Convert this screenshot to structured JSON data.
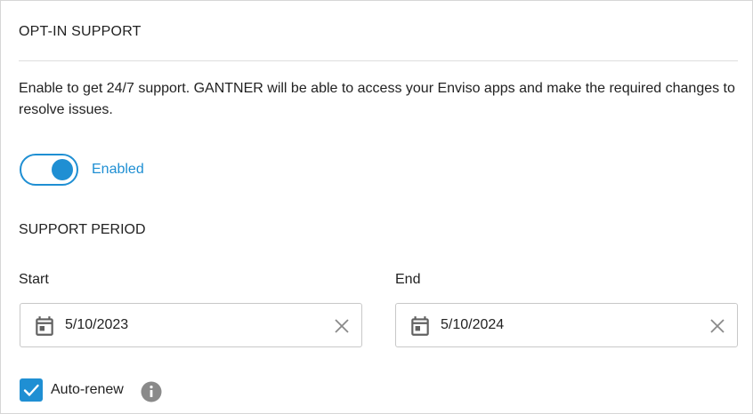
{
  "section": {
    "title": "OPT-IN SUPPORT",
    "description": "Enable to get 24/7 support. GANTNER will be able to access your Enviso apps and make the required changes to resolve issues."
  },
  "toggle": {
    "label": "Enabled",
    "state": "on"
  },
  "support_period": {
    "title": "SUPPORT PERIOD",
    "start": {
      "label": "Start",
      "value": "5/10/2023",
      "icon": "calendar-icon"
    },
    "end": {
      "label": "End",
      "value": "5/10/2024",
      "icon": "calendar-icon"
    }
  },
  "auto_renew": {
    "label": "Auto-renew",
    "checked": true,
    "info_icon": "info-icon"
  },
  "colors": {
    "accent": "#1f8fd3",
    "text": "#222222",
    "border": "#c8c8c8",
    "icon_gray": "#8a8a8a"
  }
}
